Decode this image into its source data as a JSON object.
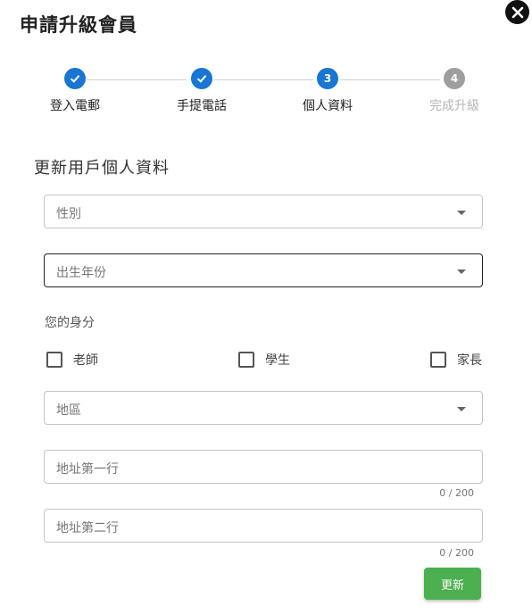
{
  "dialog": {
    "title": "申請升級會員",
    "close_icon": "close-icon"
  },
  "stepper": {
    "steps": [
      {
        "label": "登入電郵",
        "state": "done",
        "number": ""
      },
      {
        "label": "手提電話",
        "state": "done",
        "number": ""
      },
      {
        "label": "個人資料",
        "state": "active",
        "number": "3"
      },
      {
        "label": "完成升級",
        "state": "pending",
        "number": "4"
      }
    ]
  },
  "form": {
    "section_title": "更新用戶個人資料",
    "gender_placeholder": "性別",
    "birth_year_placeholder": "出生年份",
    "identity_label": "您的身分",
    "identity_options": [
      "老師",
      "學生",
      "家長"
    ],
    "region_placeholder": "地區",
    "address1_placeholder": "地址第一行",
    "address1_counter": "0 / 200",
    "address2_placeholder": "地址第二行",
    "address2_counter": "0 / 200",
    "submit_label": "更新"
  },
  "colors": {
    "primary": "#1976d2",
    "pending": "#9e9e9e",
    "submit": "#4caf50"
  }
}
